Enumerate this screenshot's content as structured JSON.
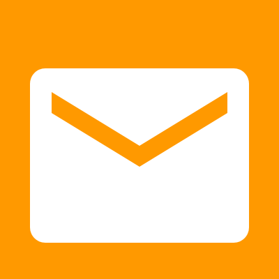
{
  "icon": {
    "name": "mail-icon",
    "background_color": "#FF9900",
    "envelope_color": "#FFFFFF",
    "flap_color": "#FF9900"
  }
}
